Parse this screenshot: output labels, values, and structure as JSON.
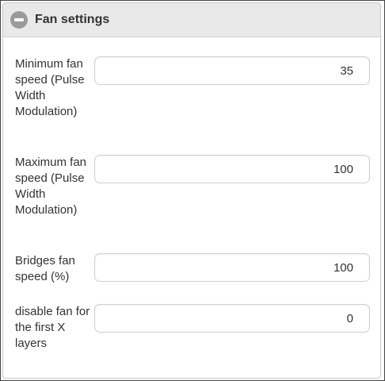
{
  "panel": {
    "title": "Fan settings",
    "collapse_icon": "minus-circle-icon"
  },
  "fields": [
    {
      "label": "Minimum fan speed (Pulse Width Modulation)",
      "value": "35"
    },
    {
      "label": "Maximum fan speed (Pulse Width Modulation)",
      "value": "100"
    },
    {
      "label": "Bridges fan speed (%)",
      "value": "100"
    },
    {
      "label": "disable fan for the first X layers",
      "value": "0"
    }
  ]
}
